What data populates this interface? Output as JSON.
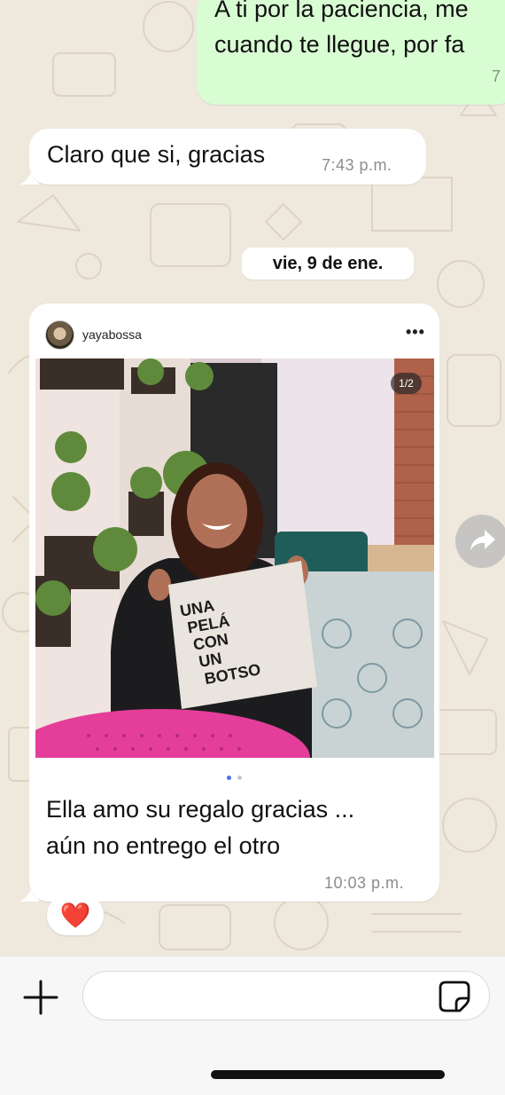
{
  "messages": {
    "outgoing_top": {
      "line1": "A ti por la paciencia, me",
      "line2": "cuando te llegue, por fa",
      "time": "7"
    },
    "incoming_1": {
      "text": "Claro que si, gracias",
      "time": "7:43 p.m."
    },
    "date_separator": "vie, 9 de ene.",
    "incoming_post": {
      "username": "yayabossa",
      "more": "•••",
      "counter": "1/2",
      "bag_text": [
        "UNA",
        "PELÁ",
        "CON",
        "UN",
        "BOTSO"
      ],
      "caption_line1": "Ella amo su regalo gracias ...",
      "caption_line2": "aún no entrego el otro",
      "time": "10:03 p.m."
    },
    "reaction": "❤️"
  },
  "composer": {
    "placeholder": ""
  },
  "colors": {
    "outgoing_bubble": "#d9fdd3",
    "incoming_bubble": "#ffffff",
    "wallpaper": "#efe8dd",
    "timestamp": "#8a8f89",
    "reaction_heart": "#e0172f"
  },
  "icons": {
    "plus": "plus-icon",
    "sticker": "sticker-icon",
    "forward": "forward-arrow-icon",
    "more": "more-horizontal-icon"
  }
}
